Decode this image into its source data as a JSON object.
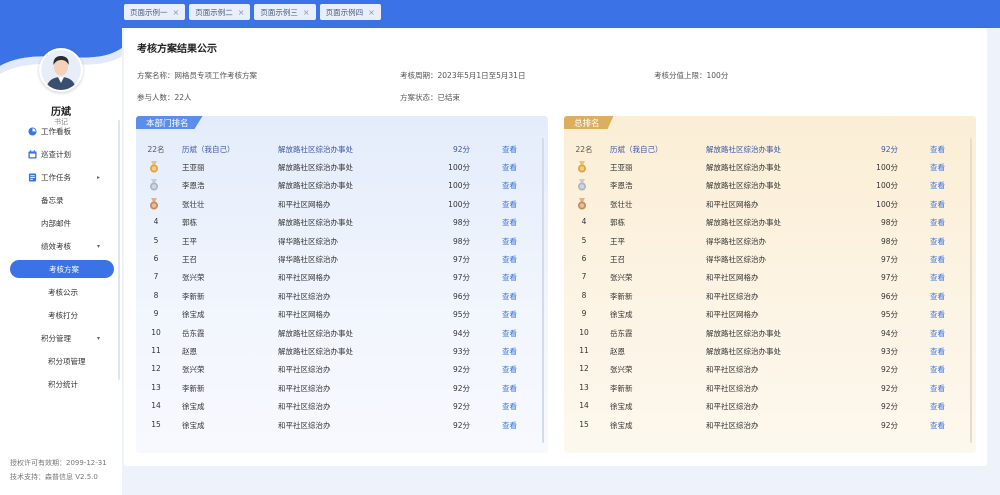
{
  "tabs": [
    {
      "label": "页面示例一"
    },
    {
      "label": "页面示例二"
    },
    {
      "label": "页面示例三"
    },
    {
      "label": "页面示例四"
    }
  ],
  "tab_close_glyph": "×",
  "user": {
    "name": "历斌",
    "role": "书记"
  },
  "menu": {
    "items": [
      {
        "label": "工作看板",
        "icon": "dashboard-icon"
      },
      {
        "label": "巡查计划",
        "icon": "calendar-icon"
      },
      {
        "label": "工作任务",
        "icon": "task-icon"
      },
      {
        "label": "备忘录"
      },
      {
        "label": "内部邮件"
      },
      {
        "label": "绩效考核"
      },
      {
        "label": "考核方案"
      },
      {
        "label": "考核公示"
      },
      {
        "label": "考核打分"
      },
      {
        "label": "积分管理"
      },
      {
        "label": "积分项管理"
      },
      {
        "label": "积分统计"
      }
    ],
    "caret_right": "▸",
    "caret_down": "▾"
  },
  "footer": {
    "license": "授权许可有效期：2099-12-31",
    "support": "技术支持：森普信息  V2.5.0"
  },
  "panel": {
    "title": "考核方案结果公示",
    "plan_name": "方案名称：网格员专项工作考核方案",
    "period": "考核周期：2023年5月1日至5月31日",
    "full_score": "考核分值上限：100分",
    "participants": "参与人数：22人",
    "status": "方案状态：已结束"
  },
  "dept_board": {
    "title": "本部门排名",
    "self": {
      "rank": "22名",
      "name": "历斌（我自己）",
      "org": "解放路社区综治办事处",
      "score": "92分",
      "action": "查看"
    },
    "rows": [
      {
        "rank": "1",
        "name": "王亚丽",
        "org": "解放路社区综治办事处",
        "score": "100分",
        "action": "查看"
      },
      {
        "rank": "2",
        "name": "李恩浩",
        "org": "解放路社区综治办事处",
        "score": "100分",
        "action": "查看"
      },
      {
        "rank": "3",
        "name": "张壮壮",
        "org": "和平社区网格办",
        "score": "100分",
        "action": "查看"
      },
      {
        "rank": "4",
        "name": "郭栋",
        "org": "解放路社区综治办事处",
        "score": "98分",
        "action": "查看"
      },
      {
        "rank": "5",
        "name": "王平",
        "org": "得华路社区综治办",
        "score": "98分",
        "action": "查看"
      },
      {
        "rank": "6",
        "name": "王召",
        "org": "得华路社区综治办",
        "score": "97分",
        "action": "查看"
      },
      {
        "rank": "7",
        "name": "张兴荣",
        "org": "和平社区网格办",
        "score": "97分",
        "action": "查看"
      },
      {
        "rank": "8",
        "name": "李新新",
        "org": "和平社区综治办",
        "score": "96分",
        "action": "查看"
      },
      {
        "rank": "9",
        "name": "徐宝成",
        "org": "和平社区网格办",
        "score": "95分",
        "action": "查看"
      },
      {
        "rank": "10",
        "name": "岳东霞",
        "org": "解放路社区综治办事处",
        "score": "94分",
        "action": "查看"
      },
      {
        "rank": "11",
        "name": "赵恩",
        "org": "解放路社区综治办事处",
        "score": "93分",
        "action": "查看"
      },
      {
        "rank": "12",
        "name": "张兴荣",
        "org": "和平社区综治办",
        "score": "92分",
        "action": "查看"
      },
      {
        "rank": "13",
        "name": "李新新",
        "org": "和平社区综治办",
        "score": "92分",
        "action": "查看"
      },
      {
        "rank": "14",
        "name": "徐宝成",
        "org": "和平社区综治办",
        "score": "92分",
        "action": "查看"
      },
      {
        "rank": "15",
        "name": "徐宝成",
        "org": "和平社区综治办",
        "score": "92分",
        "action": "查看"
      }
    ]
  },
  "total_board": {
    "title": "总排名",
    "self": {
      "rank": "22名",
      "name": "历斌（我自己）",
      "org": "解放路社区综治办事处",
      "score": "92分",
      "action": "查看"
    },
    "rows": [
      {
        "rank": "1",
        "name": "王亚丽",
        "org": "解放路社区综治办事处",
        "score": "100分",
        "action": "查看"
      },
      {
        "rank": "2",
        "name": "李恩浩",
        "org": "解放路社区综治办事处",
        "score": "100分",
        "action": "查看"
      },
      {
        "rank": "3",
        "name": "张壮壮",
        "org": "和平社区网格办",
        "score": "100分",
        "action": "查看"
      },
      {
        "rank": "4",
        "name": "郭栋",
        "org": "解放路社区综治办事处",
        "score": "98分",
        "action": "查看"
      },
      {
        "rank": "5",
        "name": "王平",
        "org": "得华路社区综治办",
        "score": "98分",
        "action": "查看"
      },
      {
        "rank": "6",
        "name": "王召",
        "org": "得华路社区综治办",
        "score": "97分",
        "action": "查看"
      },
      {
        "rank": "7",
        "name": "张兴荣",
        "org": "和平社区网格办",
        "score": "97分",
        "action": "查看"
      },
      {
        "rank": "8",
        "name": "李新新",
        "org": "和平社区综治办",
        "score": "96分",
        "action": "查看"
      },
      {
        "rank": "9",
        "name": "徐宝成",
        "org": "和平社区网格办",
        "score": "95分",
        "action": "查看"
      },
      {
        "rank": "10",
        "name": "岳东霞",
        "org": "解放路社区综治办事处",
        "score": "94分",
        "action": "查看"
      },
      {
        "rank": "11",
        "name": "赵恩",
        "org": "解放路社区综治办事处",
        "score": "93分",
        "action": "查看"
      },
      {
        "rank": "12",
        "name": "张兴荣",
        "org": "和平社区综治办",
        "score": "92分",
        "action": "查看"
      },
      {
        "rank": "13",
        "name": "李新新",
        "org": "和平社区综治办",
        "score": "92分",
        "action": "查看"
      },
      {
        "rank": "14",
        "name": "徐宝成",
        "org": "和平社区综治办",
        "score": "92分",
        "action": "查看"
      },
      {
        "rank": "15",
        "name": "徐宝成",
        "org": "和平社区综治办",
        "score": "92分",
        "action": "查看"
      }
    ]
  },
  "colors": {
    "accent": "#3b73e6",
    "gold": "#e3a52f",
    "silver": "#a9b6c8",
    "bronze": "#c98a55"
  }
}
